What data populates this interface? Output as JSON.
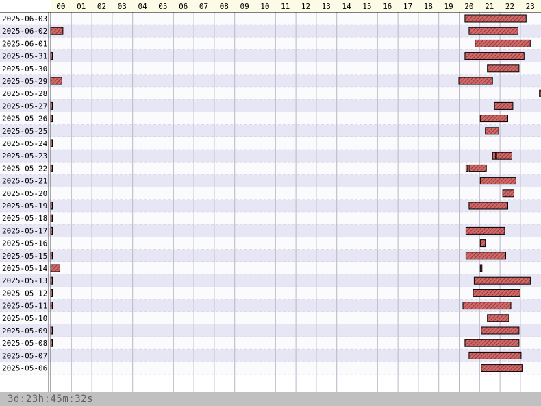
{
  "colors": {
    "bar_fill": "#d06a6a",
    "bar_hatch": "#8c2a2a",
    "bar_border": "#000000",
    "row_alt": "#e6e6f4",
    "row_base": "#fbfbfd",
    "header_bg": "#fbfbe6",
    "footer_bg": "#c0c0c0",
    "grid": "#b8b8c8"
  },
  "footer": {
    "total": "3d:23h:45m:32s"
  },
  "chart_data": {
    "type": "timeline",
    "x_unit": "hour of day",
    "hours": [
      "00",
      "01",
      "02",
      "03",
      "04",
      "05",
      "06",
      "07",
      "08",
      "09",
      "10",
      "11",
      "12",
      "13",
      "14",
      "15",
      "16",
      "17",
      "18",
      "19",
      "20",
      "21",
      "22",
      "23"
    ],
    "rows": [
      {
        "date": "2025-06-03",
        "intervals": [
          [
            20.3,
            23.3
          ]
        ]
      },
      {
        "date": "2025-06-02",
        "intervals": [
          [
            0.0,
            0.6
          ],
          [
            20.5,
            22.9
          ]
        ]
      },
      {
        "date": "2025-06-01",
        "intervals": [
          [
            20.8,
            23.5
          ]
        ]
      },
      {
        "date": "2025-05-31",
        "intervals": [
          [
            0.0,
            0.08
          ],
          [
            20.3,
            23.2
          ]
        ]
      },
      {
        "date": "2025-05-30",
        "intervals": [
          [
            21.4,
            22.95
          ]
        ]
      },
      {
        "date": "2025-05-29",
        "intervals": [
          [
            0.0,
            0.55
          ],
          [
            20.0,
            21.65
          ]
        ]
      },
      {
        "date": "2025-05-28",
        "intervals": [
          [
            23.95,
            24.0
          ]
        ]
      },
      {
        "date": "2025-05-27",
        "intervals": [
          [
            0.0,
            0.08
          ],
          [
            21.75,
            22.65
          ]
        ]
      },
      {
        "date": "2025-05-26",
        "intervals": [
          [
            0.0,
            0.08
          ],
          [
            21.05,
            22.4
          ]
        ]
      },
      {
        "date": "2025-05-25",
        "intervals": [
          [
            21.3,
            21.95
          ]
        ]
      },
      {
        "date": "2025-05-24",
        "intervals": [
          [
            0.0,
            0.08
          ]
        ]
      },
      {
        "date": "2025-05-23",
        "intervals": [
          [
            21.65,
            21.8
          ],
          [
            21.85,
            22.6
          ]
        ]
      },
      {
        "date": "2025-05-22",
        "intervals": [
          [
            0.0,
            0.08
          ],
          [
            20.35,
            20.42
          ],
          [
            20.5,
            21.35
          ]
        ]
      },
      {
        "date": "2025-05-21",
        "intervals": [
          [
            21.05,
            22.8
          ]
        ]
      },
      {
        "date": "2025-05-20",
        "intervals": [
          [
            22.15,
            22.7
          ]
        ]
      },
      {
        "date": "2025-05-19",
        "intervals": [
          [
            0.0,
            0.08
          ],
          [
            20.5,
            22.4
          ]
        ]
      },
      {
        "date": "2025-05-18",
        "intervals": [
          [
            0.0,
            0.08
          ]
        ]
      },
      {
        "date": "2025-05-17",
        "intervals": [
          [
            0.0,
            0.08
          ],
          [
            20.35,
            22.25
          ]
        ]
      },
      {
        "date": "2025-05-16",
        "intervals": [
          [
            21.05,
            21.3
          ]
        ]
      },
      {
        "date": "2025-05-15",
        "intervals": [
          [
            0.0,
            0.08
          ],
          [
            20.35,
            22.3
          ]
        ]
      },
      {
        "date": "2025-05-14",
        "intervals": [
          [
            0.0,
            0.45
          ],
          [
            21.05,
            21.12
          ]
        ]
      },
      {
        "date": "2025-05-13",
        "intervals": [
          [
            0.0,
            0.08
          ],
          [
            20.75,
            23.5
          ]
        ]
      },
      {
        "date": "2025-05-12",
        "intervals": [
          [
            0.0,
            0.08
          ],
          [
            20.7,
            23.0
          ]
        ]
      },
      {
        "date": "2025-05-11",
        "intervals": [
          [
            0.0,
            0.08
          ],
          [
            20.2,
            22.55
          ]
        ]
      },
      {
        "date": "2025-05-10",
        "intervals": [
          [
            21.4,
            22.45
          ]
        ]
      },
      {
        "date": "2025-05-09",
        "intervals": [
          [
            0.0,
            0.08
          ],
          [
            21.1,
            22.95
          ]
        ]
      },
      {
        "date": "2025-05-08",
        "intervals": [
          [
            0.0,
            0.08
          ],
          [
            20.3,
            22.95
          ]
        ]
      },
      {
        "date": "2025-05-07",
        "intervals": [
          [
            20.5,
            23.05
          ]
        ]
      },
      {
        "date": "2025-05-06",
        "intervals": [
          [
            21.1,
            23.1
          ]
        ]
      }
    ]
  }
}
